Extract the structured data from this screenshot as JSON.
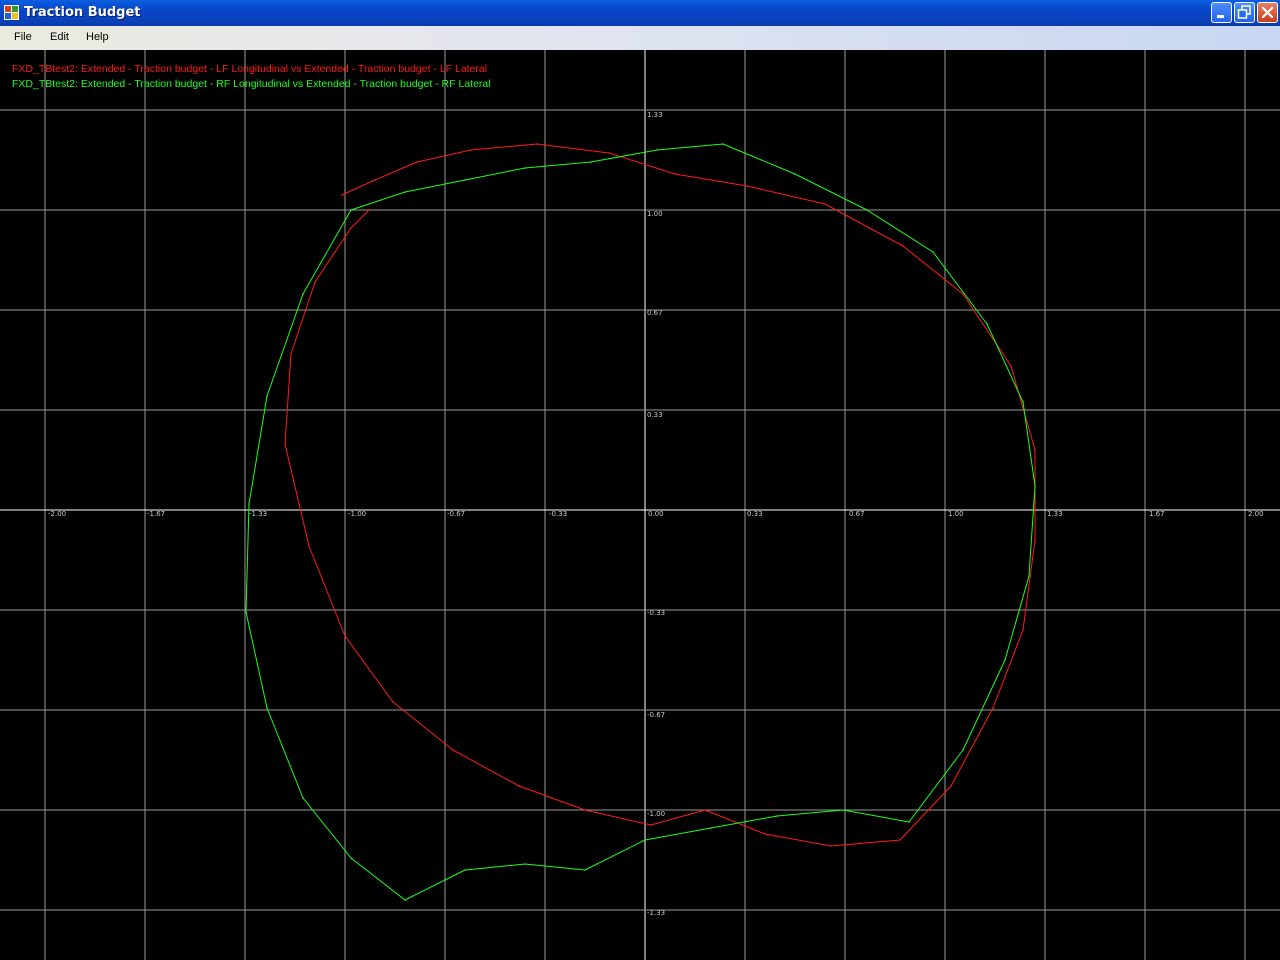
{
  "window": {
    "title": "Traction Budget",
    "minimize_label": "_",
    "maximize_label": "❐",
    "close_label": "✕"
  },
  "menu": {
    "items": [
      "File",
      "Edit",
      "Help"
    ]
  },
  "chart_data": {
    "type": "line",
    "title": "",
    "xlabel": "",
    "ylabel": "",
    "xlim": [
      -2.0,
      2.0
    ],
    "ylim": [
      -1.33,
      1.33
    ],
    "grid": true,
    "background": "#000000",
    "legend_position": "top-left",
    "x_ticks": [
      "-2.00",
      "-1.67",
      "-1.33",
      "-1.00",
      "-0.67",
      "-0.33",
      "0.00",
      "0.33",
      "0.67",
      "1.00",
      "1.33",
      "1.67",
      "2.00"
    ],
    "y_ticks": [
      "1.33",
      "1.00",
      "0.67",
      "0.33",
      "-0.33",
      "-0.67",
      "-1.00",
      "-1.33"
    ],
    "series": [
      {
        "name": "FXD_TBtest2: Extended - Traction budget - LF Longitudinal vs Extended - Traction budget - LF Lateral",
        "color": "#ff1a1a",
        "x": [
          -1.01,
          -0.9,
          -0.76,
          -0.58,
          -0.36,
          -0.12,
          0.1,
          0.34,
          0.6,
          0.86,
          1.06,
          1.22,
          1.3,
          1.3,
          1.26,
          1.16,
          1.02,
          0.85,
          0.62,
          0.4,
          0.2,
          0.02,
          -0.2,
          -0.42,
          -0.64,
          -0.84,
          -1.0,
          -1.12,
          -1.2,
          -1.18,
          -1.1,
          -0.98,
          -0.92
        ],
        "y": [
          1.05,
          1.1,
          1.16,
          1.2,
          1.22,
          1.19,
          1.12,
          1.08,
          1.02,
          0.88,
          0.72,
          0.48,
          0.2,
          -0.1,
          -0.4,
          -0.66,
          -0.92,
          -1.1,
          -1.12,
          -1.08,
          -1.0,
          -1.05,
          -1.0,
          -0.92,
          -0.8,
          -0.64,
          -0.42,
          -0.12,
          0.22,
          0.52,
          0.76,
          0.94,
          1.0
        ]
      },
      {
        "name": "FXD_TBtest2: Extended - Traction budget - RF Longitudinal vs Extended - Traction budget - RF Lateral",
        "color": "#1aff1a",
        "x": [
          -0.98,
          -0.8,
          -0.6,
          -0.4,
          -0.18,
          0.04,
          0.26,
          0.5,
          0.74,
          0.96,
          1.14,
          1.26,
          1.3,
          1.28,
          1.2,
          1.06,
          0.88,
          0.66,
          0.44,
          0.22,
          0.0,
          -0.2,
          -0.4,
          -0.6,
          -0.8,
          -0.98,
          -1.14,
          -1.26,
          -1.33,
          -1.32,
          -1.26,
          -1.14,
          -0.98
        ],
        "y": [
          1.0,
          1.06,
          1.1,
          1.14,
          1.16,
          1.2,
          1.22,
          1.12,
          1.0,
          0.86,
          0.62,
          0.36,
          0.08,
          -0.22,
          -0.5,
          -0.8,
          -1.04,
          -1.0,
          -1.02,
          -1.06,
          -1.1,
          -1.2,
          -1.18,
          -1.2,
          -1.3,
          -1.16,
          -0.96,
          -0.66,
          -0.34,
          0.02,
          0.38,
          0.72,
          1.0
        ]
      }
    ]
  }
}
